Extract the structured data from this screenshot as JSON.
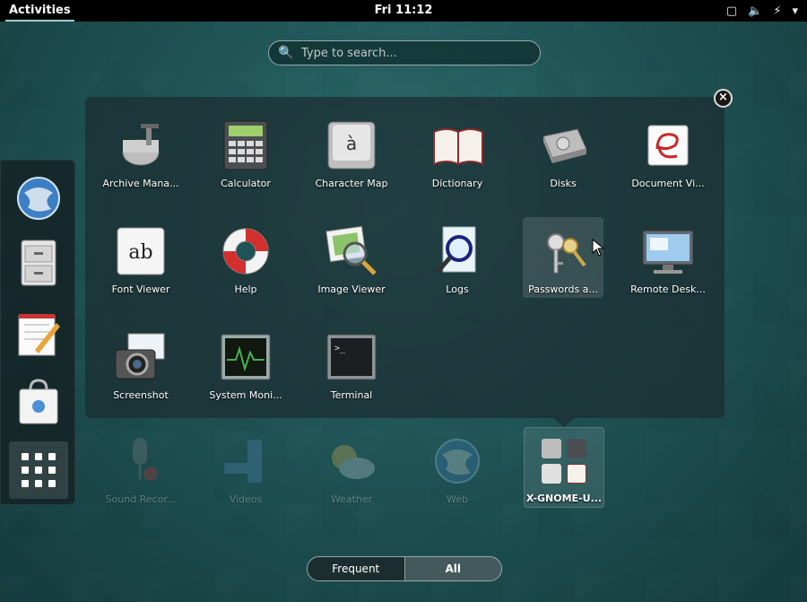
{
  "topbar": {
    "activities": "Activities",
    "clock": "Fri 11:12"
  },
  "search": {
    "placeholder": "Type to search..."
  },
  "dash": {
    "items": [
      {
        "name": "Web",
        "icon": "globe-icon"
      },
      {
        "name": "Files",
        "icon": "file-cabinet-icon"
      },
      {
        "name": "Text Editor",
        "icon": "notepad-pencil-icon"
      },
      {
        "name": "Software",
        "icon": "shopping-bag-icon"
      }
    ],
    "show_apps": "grid-icon"
  },
  "folder": {
    "apps": [
      {
        "label": "Archive Mana...",
        "icon": "archive-roller-icon"
      },
      {
        "label": "Calculator",
        "icon": "calculator-icon"
      },
      {
        "label": "Character Map",
        "icon": "character-key-icon",
        "glyph": "à"
      },
      {
        "label": "Dictionary",
        "icon": "open-book-icon"
      },
      {
        "label": "Disks",
        "icon": "disk-drive-icon"
      },
      {
        "label": "Document Vi...",
        "icon": "document-viewer-icon"
      },
      {
        "label": "Font Viewer",
        "icon": "font-viewer-icon",
        "glyph": "ab"
      },
      {
        "label": "Help",
        "icon": "life-ring-icon"
      },
      {
        "label": "Image Viewer",
        "icon": "image-magnifier-icon"
      },
      {
        "label": "Logs",
        "icon": "logs-magnifier-icon"
      },
      {
        "label": "Passwords a...",
        "icon": "keys-icon"
      },
      {
        "label": "Remote Desk...",
        "icon": "remote-desktop-icon"
      },
      {
        "label": "Screenshot",
        "icon": "camera-icon"
      },
      {
        "label": "System Moni...",
        "icon": "system-monitor-icon"
      },
      {
        "label": "Terminal",
        "icon": "terminal-icon",
        "glyph": ">_"
      }
    ]
  },
  "background_apps": [
    {
      "label": "Sound Recor...",
      "icon": "microphone-icon"
    },
    {
      "label": "Videos",
      "icon": "film-icon"
    },
    {
      "label": "Weather",
      "icon": "weather-icon"
    },
    {
      "label": "Web",
      "icon": "globe-icon"
    },
    {
      "label": "X-GNOME-U...",
      "icon": "folder-grid-icon"
    }
  ],
  "switcher": {
    "frequent": "Frequent",
    "all": "All"
  },
  "colors": {
    "accent": "#9ecfcf",
    "background": "#1f5355"
  }
}
